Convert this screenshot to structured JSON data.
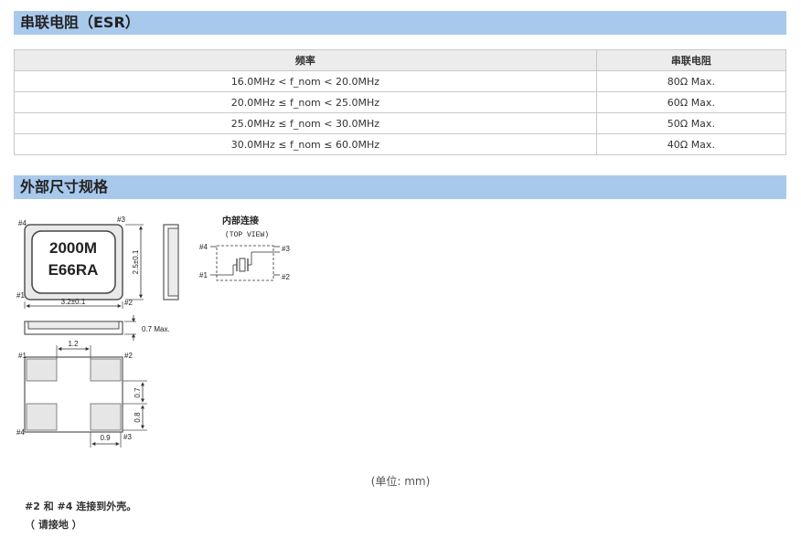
{
  "esr": {
    "title": "串联电阻（ESR）",
    "table": {
      "headers": [
        "频率",
        "串联电阻"
      ],
      "rows": [
        [
          "16.0MHz < f_nom < 20.0MHz",
          "80Ω Max."
        ],
        [
          "20.0MHz ≤ f_nom < 25.0MHz",
          "60Ω Max."
        ],
        [
          "25.0MHz ≤ f_nom < 30.0MHz",
          "50Ω Max."
        ],
        [
          "30.0MHz ≤ f_nom ≤ 60.0MHz",
          "40Ω Max."
        ]
      ]
    }
  },
  "dimensions": {
    "title": "外部尺寸规格",
    "marking_line1": "2000M",
    "marking_line2": "E66RA",
    "dim_width": "3.2±0.1",
    "dim_height": "2.5±0.1",
    "dim_thickness": "0.7 Max.",
    "dim_pad_spacing": "1.2",
    "dim_pad_height1": "0.7",
    "dim_pad_height2": "0.8",
    "dim_pad_width": "0.9",
    "pin1": "#1",
    "pin2": "#2",
    "pin3": "#3",
    "pin4": "#4",
    "internal_title": "内部连接",
    "top_view": "(TOP VIEW)",
    "unit_label": "(单位: mm)",
    "note1": "#2 和 #4 连接到外壳。",
    "note2": "（ 请接地 ）"
  }
}
